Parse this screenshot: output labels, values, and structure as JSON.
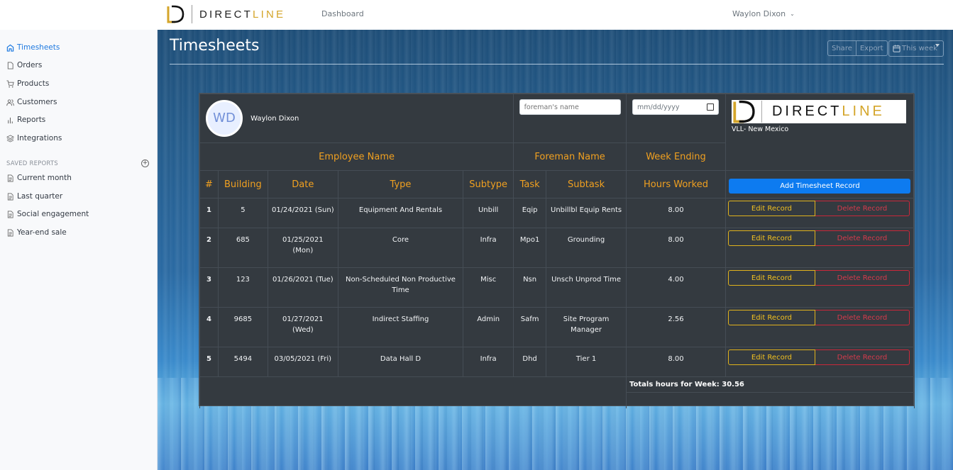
{
  "topbar": {
    "brand_word_dark": "DIRECT",
    "brand_word_gold": "LINE",
    "nav_link": "Dashboard",
    "user_name": "Waylon Dixon"
  },
  "sidebar": {
    "items": [
      {
        "label": "Timesheets",
        "icon": "home-icon",
        "active": true
      },
      {
        "label": "Orders",
        "icon": "file-icon"
      },
      {
        "label": "Products",
        "icon": "cart-icon"
      },
      {
        "label": "Customers",
        "icon": "users-icon"
      },
      {
        "label": "Reports",
        "icon": "bar-chart-icon"
      },
      {
        "label": "Integrations",
        "icon": "layers-icon"
      }
    ],
    "saved_reports_heading": "SAVED REPORTS",
    "saved_reports": [
      {
        "label": "Current month",
        "icon": "file-text-icon"
      },
      {
        "label": "Last quarter",
        "icon": "file-text-icon"
      },
      {
        "label": "Social engagement",
        "icon": "file-text-icon"
      },
      {
        "label": "Year-end sale",
        "icon": "file-text-icon"
      }
    ]
  },
  "page": {
    "title": "Timesheets",
    "share_label": "Share",
    "export_label": "Export",
    "week_label": "This week"
  },
  "card": {
    "employee_initials": "WD",
    "employee_name": "Waylon Dixon",
    "foreman_placeholder": "foreman's name",
    "date_placeholder": "mm/dd/yyyy",
    "logo_word_dark": "DIRECT",
    "logo_word_gold": "LINE",
    "location": "VLL- New Mexico",
    "headers": {
      "employee_name": "Employee Name",
      "foreman_name": "Foreman Name",
      "week_ending": "Week Ending"
    },
    "columns": [
      "#",
      "Building",
      "Date",
      "Type",
      "Subtype",
      "Task",
      "Subtask",
      "Hours Worked"
    ],
    "add_button": "Add Timesheet Record",
    "edit_label": "Edit Record",
    "delete_label": "Delete Record",
    "rows": [
      {
        "num": "1",
        "building": "5",
        "date": "01/24/2021 (Sun)",
        "type": "Equipment And Rentals",
        "subtype": "Unbill",
        "task": "Eqip",
        "subtask": "Unbillbl Equip Rents",
        "hours": "8.00"
      },
      {
        "num": "2",
        "building": "685",
        "date": "01/25/2021 (Mon)",
        "type": "Core",
        "subtype": "Infra",
        "task": "Mpo1",
        "subtask": "Grounding",
        "hours": "8.00"
      },
      {
        "num": "3",
        "building": "123",
        "date": "01/26/2021 (Tue)",
        "type": "Non-Scheduled Non Productive Time",
        "subtype": "Misc",
        "task": "Nsn",
        "subtask": "Unsch Unprod Time",
        "hours": "4.00"
      },
      {
        "num": "4",
        "building": "9685",
        "date": "01/27/2021 (Wed)",
        "type": "Indirect Staffing",
        "subtype": "Admin",
        "task": "Safm",
        "subtask": "Site Program Manager",
        "hours": "2.56"
      },
      {
        "num": "5",
        "building": "5494",
        "date": "03/05/2021 (Fri)",
        "type": "Data Hall D",
        "subtype": "Infra",
        "task": "Dhd",
        "subtask": "Tier 1",
        "hours": "8.00"
      }
    ],
    "total_text": "Totals hours for Week: 30.56"
  },
  "colors": {
    "accent_blue": "#0d7bf0",
    "header_gold": "#f0a020",
    "edit_yellow": "#f0c020",
    "delete_red": "#d63a4c",
    "card_bg": "#343a40",
    "brand_gold": "#d4a52a"
  }
}
